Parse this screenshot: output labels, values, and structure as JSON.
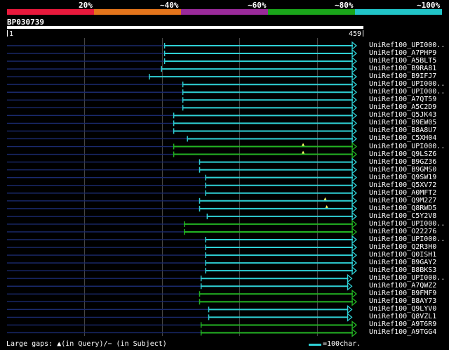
{
  "scale": {
    "labels": [
      "20%",
      "~40%",
      "~60%",
      "~80%",
      "~100%"
    ],
    "bands": [
      {
        "color": "#e8193c"
      },
      {
        "color": "#e3741b"
      },
      {
        "color": "#9a2a9a"
      },
      {
        "color": "#1aa51a"
      },
      {
        "color": "#21c4c8"
      }
    ]
  },
  "query": {
    "id": "BP030739",
    "start": "1",
    "end": "459",
    "length": 459
  },
  "colors": {
    "cyan": "#2fd1d6",
    "green": "#23b423",
    "navy": "#1a2a6e",
    "gap_marker": "#ffff66"
  },
  "hits": [
    {
      "label": "UniRef100_UPI000..",
      "start": 207,
      "end": 459,
      "color": "cyan",
      "arrow": true
    },
    {
      "label": "UniRef100_A7PHP9",
      "start": 207,
      "end": 459,
      "color": "cyan",
      "arrow": true
    },
    {
      "label": "UniRef100_A5BLT5",
      "start": 207,
      "end": 459,
      "color": "cyan",
      "arrow": true
    },
    {
      "label": "UniRef100_B9RA81",
      "start": 203,
      "end": 459,
      "color": "cyan",
      "arrow": true
    },
    {
      "label": "UniRef100_B9IFJ7",
      "start": 187,
      "end": 459,
      "color": "cyan",
      "arrow": true
    },
    {
      "label": "UniRef100_UPI000..",
      "start": 231,
      "end": 459,
      "color": "cyan",
      "arrow": true
    },
    {
      "label": "UniRef100_UPI000..",
      "start": 231,
      "end": 459,
      "color": "cyan",
      "arrow": true
    },
    {
      "label": "UniRef100_A7QT59",
      "start": 231,
      "end": 459,
      "color": "cyan",
      "arrow": true
    },
    {
      "label": "UniRef100_A5C2D9",
      "start": 231,
      "end": 459,
      "color": "cyan",
      "arrow": true
    },
    {
      "label": "UniRef100_Q5JK43",
      "start": 219,
      "end": 459,
      "color": "cyan",
      "arrow": true
    },
    {
      "label": "UniRef100_B9EW05",
      "start": 219,
      "end": 459,
      "color": "cyan",
      "arrow": true
    },
    {
      "label": "UniRef100_B8A8U7",
      "start": 219,
      "end": 459,
      "color": "cyan",
      "arrow": true
    },
    {
      "label": "UniRef100_C5XH04",
      "start": 237,
      "end": 459,
      "color": "cyan",
      "arrow": true
    },
    {
      "label": "UniRef100_UPI000..",
      "start": 219,
      "end": 459,
      "color": "green",
      "arrow": true
    },
    {
      "label": "UniRef100_Q9LSZ6",
      "start": 219,
      "end": 459,
      "color": "green",
      "arrow": true
    },
    {
      "label": "UniRef100_B9GZ36",
      "start": 253,
      "end": 459,
      "color": "cyan",
      "arrow": true
    },
    {
      "label": "UniRef100_B9GMS0",
      "start": 253,
      "end": 459,
      "color": "cyan",
      "arrow": true
    },
    {
      "label": "UniRef100_Q9SW19",
      "start": 261,
      "end": 459,
      "color": "cyan",
      "arrow": true
    },
    {
      "label": "UniRef100_Q5XV72",
      "start": 261,
      "end": 459,
      "color": "cyan",
      "arrow": true
    },
    {
      "label": "UniRef100_A0MFT2",
      "start": 261,
      "end": 459,
      "color": "cyan",
      "arrow": true
    },
    {
      "label": "UniRef100_Q9M2Z7",
      "start": 253,
      "end": 459,
      "color": "cyan",
      "arrow": true
    },
    {
      "label": "UniRef100_Q8RWD5",
      "start": 253,
      "end": 459,
      "color": "cyan",
      "arrow": true
    },
    {
      "label": "UniRef100_C5Y2V8",
      "start": 263,
      "end": 459,
      "color": "cyan",
      "arrow": true
    },
    {
      "label": "UniRef100_UPI000..",
      "start": 233,
      "end": 459,
      "color": "green",
      "arrow": true
    },
    {
      "label": "UniRef100_O22276",
      "start": 233,
      "end": 459,
      "color": "green",
      "arrow": true
    },
    {
      "label": "UniRef100_UPI000..",
      "start": 261,
      "end": 459,
      "color": "cyan",
      "arrow": true
    },
    {
      "label": "UniRef100_Q2R3H0",
      "start": 261,
      "end": 459,
      "color": "cyan",
      "arrow": true
    },
    {
      "label": "UniRef100_Q0ISH1",
      "start": 261,
      "end": 459,
      "color": "cyan",
      "arrow": true
    },
    {
      "label": "UniRef100_B9GAY2",
      "start": 261,
      "end": 459,
      "color": "cyan",
      "arrow": true
    },
    {
      "label": "UniRef100_B8BKS3",
      "start": 261,
      "end": 459,
      "color": "cyan",
      "arrow": true
    },
    {
      "label": "UniRef100_UPI000..",
      "start": 255,
      "end": 453,
      "color": "cyan",
      "arrow": true
    },
    {
      "label": "UniRef100_A7QWZ2",
      "start": 255,
      "end": 453,
      "color": "cyan",
      "arrow": true
    },
    {
      "label": "UniRef100_B9FMF9",
      "start": 253,
      "end": 459,
      "color": "green",
      "arrow": true
    },
    {
      "label": "UniRef100_B8AY73",
      "start": 253,
      "end": 459,
      "color": "green",
      "arrow": true
    },
    {
      "label": "UniRef100_Q9LYV0",
      "start": 265,
      "end": 453,
      "color": "cyan",
      "arrow": true
    },
    {
      "label": "UniRef100_Q8VZL1",
      "start": 265,
      "end": 453,
      "color": "cyan",
      "arrow": true
    },
    {
      "label": "UniRef100_A9T6R9",
      "start": 255,
      "end": 459,
      "color": "green",
      "arrow": true
    },
    {
      "label": "UniRef100_A9TGG4",
      "start": 255,
      "end": 459,
      "color": "green",
      "arrow": true
    }
  ],
  "gap_markers": [
    {
      "row": 13,
      "pos": 389
    },
    {
      "row": 14,
      "pos": 389
    },
    {
      "row": 20,
      "pos": 418
    },
    {
      "row": 21,
      "pos": 420
    }
  ],
  "legend": {
    "left": "Large gaps: ▲(in Query)/− (in Subject)",
    "right": "=100char."
  }
}
